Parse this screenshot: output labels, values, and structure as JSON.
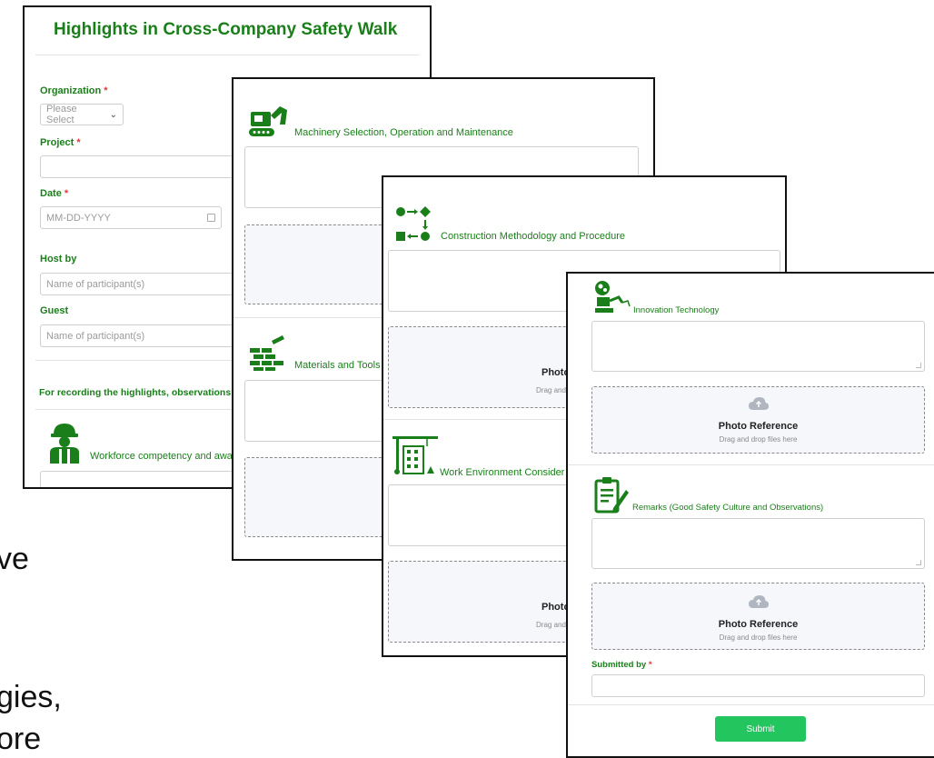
{
  "slide": {
    "line1": "ve",
    "line2": "gies,",
    "line3": "ore"
  },
  "card1": {
    "title": "Highlights in Cross-Company Safety Walk",
    "organization_label": "Organization",
    "required_mark": "*",
    "organization_value": "Please Select",
    "project_label": "Project",
    "project_value": "",
    "date_label": "Date",
    "date_placeholder": "MM-DD-YYYY",
    "host_label": "Host by",
    "host_placeholder": "Name of participant(s)",
    "guest_label": "Guest",
    "guest_placeholder": "Name of participant(s)",
    "recording_note": "For recording the highlights, observations a",
    "workforce_title": "Workforce competency and awa"
  },
  "card2": {
    "machinery_title": "Machinery Selection, Operation and Maintenance",
    "materials_title": "Materials and Tools"
  },
  "card3": {
    "construction_title": "Construction Methodology and Procedure",
    "dz_title_partial": "Photo",
    "dz_sub_partial": "Drag and",
    "work_env_title": "Work Environment Consider",
    "dz2_title_partial": "Photo",
    "dz2_sub_partial": "Drag and"
  },
  "card4": {
    "innovation_title": "Innovation Technology",
    "photo_reference": "Photo Reference",
    "drag_drop": "Drag and drop files here",
    "remarks_title": "Remarks (Good Safety Culture and Observations)",
    "photo_reference_2": "Photo Reference",
    "drag_drop_2": "Drag and drop files here",
    "submitted_by_label": "Submitted by",
    "submit_label": "Submit"
  },
  "colors": {
    "accent": "#1a7f1a",
    "submit_bg": "#22c55e",
    "required": "#e03b3b"
  }
}
